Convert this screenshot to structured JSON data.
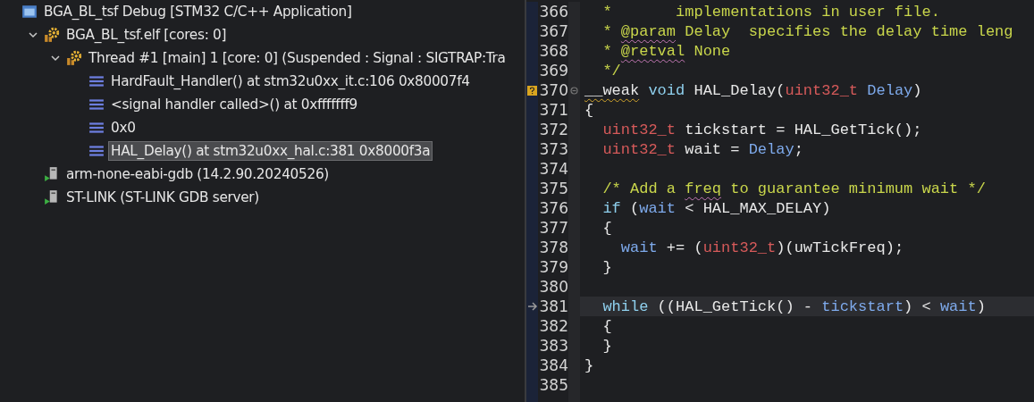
{
  "debug_tree": [
    {
      "kind": "launch",
      "label": "BGA_BL_tsf Debug [STM32 C/C++ Application]",
      "selected": false,
      "children": [
        {
          "kind": "target",
          "label": "BGA_BL_tsf.elf [cores: 0]",
          "expanded": true,
          "selected": false,
          "children": [
            {
              "kind": "thread",
              "label": "Thread #1 [main] 1 [core: 0] (Suspended : Signal : SIGTRAP:Tra",
              "expanded": true,
              "selected": false,
              "children": [
                {
                  "kind": "frame",
                  "label": "HardFault_Handler() at stm32u0xx_it.c:106 0x80007f4",
                  "selected": false
                },
                {
                  "kind": "frame",
                  "label": "<signal handler called>() at 0xfffffff9",
                  "selected": false
                },
                {
                  "kind": "frame",
                  "label": "0x0",
                  "selected": false
                },
                {
                  "kind": "frame",
                  "label": "HAL_Delay() at stm32u0xx_hal.c:381 0x8000f3a",
                  "selected": true
                }
              ]
            }
          ]
        },
        {
          "kind": "process",
          "label": "arm-none-eabi-gdb (14.2.90.20240526)",
          "selected": false
        },
        {
          "kind": "process",
          "label": "ST-LINK (ST-LINK GDB server)",
          "selected": false
        }
      ]
    }
  ],
  "editor": {
    "lines": [
      {
        "number": "366",
        "current": false,
        "tokens": [
          {
            "kind": "comment",
            "text": "  *       implementations in user file."
          }
        ]
      },
      {
        "number": "367",
        "current": false,
        "tokens": [
          {
            "kind": "comment",
            "text": "  * "
          },
          {
            "kind": "comment",
            "text": "@param",
            "misspelled": true
          },
          {
            "kind": "comment",
            "text": " Delay  specifies the delay time leng"
          }
        ]
      },
      {
        "number": "368",
        "current": false,
        "tokens": [
          {
            "kind": "comment",
            "text": "  * "
          },
          {
            "kind": "comment",
            "text": "@retval",
            "misspelled": true
          },
          {
            "kind": "comment",
            "text": " None"
          }
        ]
      },
      {
        "number": "369",
        "current": false,
        "tokens": [
          {
            "kind": "comment",
            "text": "  */"
          }
        ]
      },
      {
        "number": "370",
        "current": false,
        "warning": true,
        "fold": true,
        "tokens": [
          {
            "kind": "plain",
            "text": "__weak",
            "warning": true
          },
          {
            "kind": "keyword",
            "text": " void"
          },
          {
            "kind": "plain",
            "text": " HAL_Delay("
          },
          {
            "kind": "type",
            "text": "uint32_t"
          },
          {
            "kind": "variable",
            "text": " Delay"
          },
          {
            "kind": "plain",
            "text": ")"
          }
        ]
      },
      {
        "number": "371",
        "current": false,
        "tokens": [
          {
            "kind": "plain",
            "text": "{"
          }
        ]
      },
      {
        "number": "372",
        "current": false,
        "tokens": [
          {
            "kind": "type",
            "text": "  uint32_t"
          },
          {
            "kind": "plain",
            "text": " tickstart = HAL_GetTick();"
          }
        ]
      },
      {
        "number": "373",
        "current": false,
        "tokens": [
          {
            "kind": "type",
            "text": "  uint32_t"
          },
          {
            "kind": "plain",
            "text": " wait = "
          },
          {
            "kind": "variable",
            "text": "Delay"
          },
          {
            "kind": "plain",
            "text": ";"
          }
        ]
      },
      {
        "number": "374",
        "current": false
      },
      {
        "number": "375",
        "current": false,
        "tokens": [
          {
            "kind": "comment",
            "text": "  /* Add a "
          },
          {
            "kind": "comment",
            "text": "freq",
            "misspelled": true
          },
          {
            "kind": "comment",
            "text": " to guarantee minimum wait */"
          }
        ]
      },
      {
        "number": "376",
        "current": false,
        "tokens": [
          {
            "kind": "keyword",
            "text": "  if"
          },
          {
            "kind": "plain",
            "text": " ("
          },
          {
            "kind": "variable",
            "text": "wait"
          },
          {
            "kind": "plain",
            "text": " < HAL_MAX_DELAY)"
          }
        ]
      },
      {
        "number": "377",
        "current": false,
        "tokens": [
          {
            "kind": "plain",
            "text": "  {"
          }
        ]
      },
      {
        "number": "378",
        "current": false,
        "tokens": [
          {
            "kind": "variable",
            "text": "    wait"
          },
          {
            "kind": "plain",
            "text": " += ("
          },
          {
            "kind": "type",
            "text": "uint32_t"
          },
          {
            "kind": "plain",
            "text": ")(uwTickFreq);"
          }
        ]
      },
      {
        "number": "379",
        "current": false,
        "tokens": [
          {
            "kind": "plain",
            "text": "  }"
          }
        ]
      },
      {
        "number": "380",
        "current": false
      },
      {
        "number": "381",
        "current": true,
        "tokens": [
          {
            "kind": "keyword",
            "text": "  while"
          },
          {
            "kind": "plain",
            "text": " ((HAL_GetTick() - "
          },
          {
            "kind": "variable",
            "text": "tickstart"
          },
          {
            "kind": "plain",
            "text": ") < "
          },
          {
            "kind": "variable",
            "text": "wait"
          },
          {
            "kind": "plain",
            "text": ")"
          }
        ]
      },
      {
        "number": "382",
        "current": false,
        "tokens": [
          {
            "kind": "plain",
            "text": "  {"
          }
        ]
      },
      {
        "number": "383",
        "current": false,
        "tokens": [
          {
            "kind": "plain",
            "text": "  }"
          }
        ]
      },
      {
        "number": "384",
        "current": false,
        "tokens": [
          {
            "kind": "plain",
            "text": "}"
          }
        ]
      },
      {
        "number": "385",
        "current": false
      }
    ]
  }
}
